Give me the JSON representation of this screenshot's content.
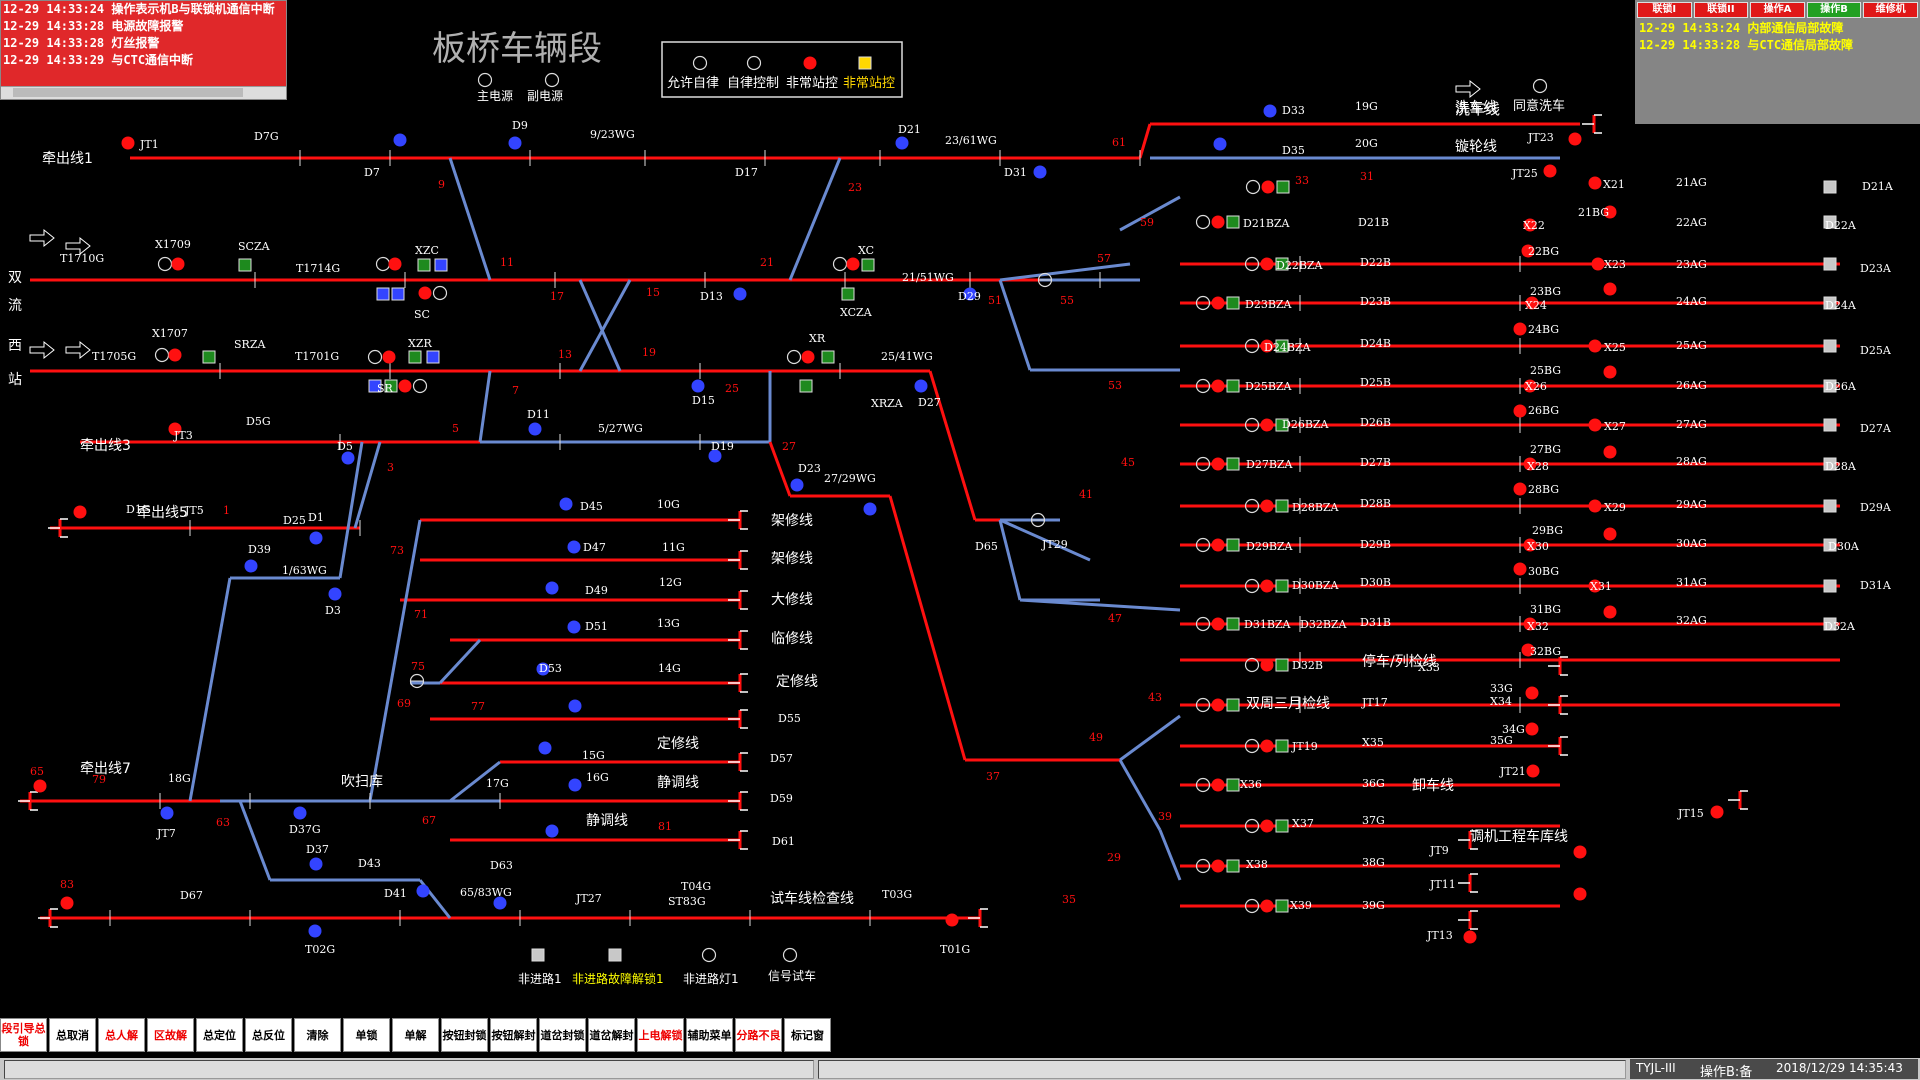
{
  "title": "板桥车辆段",
  "legend": {
    "indicators": [
      "允许自律",
      "自律控制",
      "非常站控",
      "非常站控"
    ],
    "power": [
      "主电源",
      "副电源"
    ],
    "wash": [
      "洗车线",
      "同意洗车"
    ]
  },
  "alarms_left": [
    "12-29 14:33:24 操作表示机B与联锁机通信中断",
    "12-29 14:33:28 电源故障报警",
    "12-29 14:33:28 灯丝报警",
    "12-29 14:33:29 与CTC通信中断"
  ],
  "alarms_right": {
    "tabs": [
      "联锁I",
      "联锁II",
      "操作A",
      "操作B",
      "维修机"
    ],
    "lines": [
      "12-29 14:33:24 内部通信局部故障",
      "12-29 14:33:28 与CTC通信局部故障"
    ]
  },
  "toolbar": [
    "段引导总锁",
    "总取消",
    "总人解",
    "区故解",
    "总定位",
    "总反位",
    "清除",
    "单锁",
    "单解",
    "按钮封锁",
    "按钮解封",
    "道岔封锁",
    "道岔解封",
    "上电解锁",
    "辅助菜单",
    "分路不良",
    "标记窗"
  ],
  "status": {
    "system": "TYJL-III",
    "mode": "操作B:备",
    "time": "2018/12/29 14:35:43"
  },
  "colors": {
    "route": "#ff1010",
    "track": "#6a8ad0",
    "alarm": "#e0282a",
    "signal_blue": "#3344ff",
    "signal_red": "#ff1010",
    "signal_green": "#1e8a1e"
  },
  "bottom_buttons": [
    "非进路1",
    "非进路故障解锁1",
    "非进路灯1",
    "信号试车"
  ],
  "labels": [
    [
      "牵出线1",
      0
    ],
    [
      "牵出线3",
      0
    ],
    [
      "牵出线5",
      0
    ],
    [
      "牵出线7",
      0
    ],
    [
      "双",
      0
    ],
    [
      "流",
      0
    ],
    [
      "西",
      0
    ],
    [
      "站",
      0
    ],
    [
      "JT1",
      1
    ],
    [
      "D7G",
      1
    ],
    [
      "D9",
      1
    ],
    [
      "9/23WG",
      1
    ],
    [
      "D21",
      1
    ],
    [
      "23/61WG",
      1
    ],
    [
      "61",
      2
    ],
    [
      "D33",
      1
    ],
    [
      "19G",
      1
    ],
    [
      "20G",
      1
    ],
    [
      "D35",
      1
    ],
    [
      "JT23",
      1
    ],
    [
      "JT25",
      1
    ],
    [
      "洗车线",
      0
    ],
    [
      "镟轮线",
      0
    ],
    [
      "D7",
      1
    ],
    [
      "9",
      2
    ],
    [
      "D17",
      1
    ],
    [
      "23",
      2
    ],
    [
      "D31",
      1
    ],
    [
      "X1709",
      1
    ],
    [
      "SCZA",
      1
    ],
    [
      "XZC",
      1
    ],
    [
      "XC",
      1
    ],
    [
      "T1710G",
      1
    ],
    [
      "T1714G",
      1
    ],
    [
      "11",
      2
    ],
    [
      "21",
      2
    ],
    [
      "21/51WG",
      1
    ],
    [
      "57",
      2
    ],
    [
      "59",
      2
    ],
    [
      "SC",
      1
    ],
    [
      "17",
      2
    ],
    [
      "15",
      2
    ],
    [
      "D13",
      1
    ],
    [
      "XCZA",
      1
    ],
    [
      "D29",
      1
    ],
    [
      "51",
      2
    ],
    [
      "55",
      2
    ],
    [
      "X1707",
      1
    ],
    [
      "SRZA",
      1
    ],
    [
      "XZR",
      1
    ],
    [
      "XR",
      1
    ],
    [
      "T1705G",
      1
    ],
    [
      "T1701G",
      1
    ],
    [
      "13",
      2
    ],
    [
      "19",
      2
    ],
    [
      "25/41WG",
      1
    ],
    [
      "SR",
      1
    ],
    [
      "7",
      2
    ],
    [
      "D15",
      1
    ],
    [
      "25",
      2
    ],
    [
      "XRZA",
      1
    ],
    [
      "D27",
      1
    ],
    [
      "53",
      2
    ],
    [
      "JT3",
      1
    ],
    [
      "D5G",
      1
    ],
    [
      "5",
      2
    ],
    [
      "D11",
      1
    ],
    [
      "5/27WG",
      1
    ],
    [
      "D5",
      1
    ],
    [
      "3",
      2
    ],
    [
      "D19",
      1
    ],
    [
      "27",
      2
    ],
    [
      "D23",
      1
    ],
    [
      "27/29WG",
      1
    ],
    [
      "JT5",
      1
    ],
    [
      "D1G",
      1
    ],
    [
      "1",
      2
    ],
    [
      "D1",
      1
    ],
    [
      "D25",
      1
    ],
    [
      "D39",
      1
    ],
    [
      "1/63WG",
      1
    ],
    [
      "D3",
      1
    ],
    [
      "D45",
      1
    ],
    [
      "10G",
      1
    ],
    [
      "架修线",
      0
    ],
    [
      "D47",
      1
    ],
    [
      "11G",
      1
    ],
    [
      "架修线",
      0
    ],
    [
      "73",
      2
    ],
    [
      "D49",
      1
    ],
    [
      "12G",
      1
    ],
    [
      "大修线",
      0
    ],
    [
      "71",
      2
    ],
    [
      "D51",
      1
    ],
    [
      "13G",
      1
    ],
    [
      "临修线",
      0
    ],
    [
      "75",
      2
    ],
    [
      "D53",
      1
    ],
    [
      "14G",
      1
    ],
    [
      "定修线",
      0
    ],
    [
      "69",
      2
    ],
    [
      "77",
      2
    ],
    [
      "D55",
      1
    ],
    [
      "15G",
      1
    ],
    [
      "定修线",
      0
    ],
    [
      "D57",
      1
    ],
    [
      "16G",
      1
    ],
    [
      "静调线",
      0
    ],
    [
      "D59",
      1
    ],
    [
      "17G",
      1
    ],
    [
      "静调线",
      0
    ],
    [
      "81",
      2
    ],
    [
      "D61",
      1
    ],
    [
      "18G",
      1
    ],
    [
      "吹扫库",
      0
    ],
    [
      "63",
      2
    ],
    [
      "67",
      2
    ],
    [
      "65",
      2
    ],
    [
      "79",
      2
    ],
    [
      "JT7",
      1
    ],
    [
      "D37G",
      1
    ],
    [
      "D37",
      1
    ],
    [
      "D43",
      1
    ],
    [
      "D41",
      1
    ],
    [
      "65/83WG",
      1
    ],
    [
      "D63",
      1
    ],
    [
      "83",
      2
    ],
    [
      "D67",
      1
    ],
    [
      "JT27",
      1
    ],
    [
      "T04G",
      1
    ],
    [
      "ST83G",
      1
    ],
    [
      "试车线检查线",
      0
    ],
    [
      "T03G",
      1
    ],
    [
      "T02G",
      1
    ],
    [
      "T01G",
      1
    ],
    [
      "D65",
      1
    ],
    [
      "JT29",
      1
    ],
    [
      "41",
      2
    ],
    [
      "45",
      2
    ],
    [
      "47",
      2
    ],
    [
      "49",
      2
    ],
    [
      "43",
      2
    ],
    [
      "37",
      2
    ],
    [
      "39",
      2
    ],
    [
      "29",
      2
    ],
    [
      "35",
      2
    ],
    [
      "33",
      2
    ],
    [
      "31",
      2
    ],
    [
      "X21",
      1
    ],
    [
      "21AG",
      1
    ],
    [
      "D21A",
      1
    ],
    [
      "21BG",
      1
    ],
    [
      "D21BZA",
      1
    ],
    [
      "D21B",
      1
    ],
    [
      "X22",
      1
    ],
    [
      "22AG",
      1
    ],
    [
      "D22A",
      1
    ],
    [
      "22BG",
      1
    ],
    [
      "D22BZA",
      1
    ],
    [
      "D22B",
      1
    ],
    [
      "X23",
      1
    ],
    [
      "23AG",
      1
    ],
    [
      "D23A",
      1
    ],
    [
      "23BG",
      1
    ],
    [
      "D23BZA",
      1
    ],
    [
      "D23B",
      1
    ],
    [
      "X24",
      1
    ],
    [
      "24AG",
      1
    ],
    [
      "D24A",
      1
    ],
    [
      "24BG",
      1
    ],
    [
      "D24BZA",
      1
    ],
    [
      "D24B",
      1
    ],
    [
      "X25",
      1
    ],
    [
      "25AG",
      1
    ],
    [
      "D25A",
      1
    ],
    [
      "25BG",
      1
    ],
    [
      "D25BZA",
      1
    ],
    [
      "D25B",
      1
    ],
    [
      "X26",
      1
    ],
    [
      "26AG",
      1
    ],
    [
      "D26A",
      1
    ],
    [
      "26BG",
      1
    ],
    [
      "D26BZA",
      1
    ],
    [
      "D26B",
      1
    ],
    [
      "X27",
      1
    ],
    [
      "27AG",
      1
    ],
    [
      "D27A",
      1
    ],
    [
      "27BG",
      1
    ],
    [
      "D27BZA",
      1
    ],
    [
      "D27B",
      1
    ],
    [
      "X28",
      1
    ],
    [
      "28AG",
      1
    ],
    [
      "D28A",
      1
    ],
    [
      "28BG",
      1
    ],
    [
      "D28BZA",
      1
    ],
    [
      "D28B",
      1
    ],
    [
      "X29",
      1
    ],
    [
      "29AG",
      1
    ],
    [
      "D29A",
      1
    ],
    [
      "29BG",
      1
    ],
    [
      "D29BZA",
      1
    ],
    [
      "D29B",
      1
    ],
    [
      "X30",
      1
    ],
    [
      "30AG",
      1
    ],
    [
      "D30A",
      1
    ],
    [
      "30BG",
      1
    ],
    [
      "D30BZA",
      1
    ],
    [
      "D30B",
      1
    ],
    [
      "X31",
      1
    ],
    [
      "31AG",
      1
    ],
    [
      "D31A",
      1
    ],
    [
      "31BG",
      1
    ],
    [
      "D31BZA",
      1
    ],
    [
      "D31B",
      1
    ],
    [
      "X32",
      1
    ],
    [
      "32AG",
      1
    ],
    [
      "D32A",
      1
    ],
    [
      "32BG",
      1
    ],
    [
      "D32BZA",
      1
    ],
    [
      "D32B",
      1
    ],
    [
      "停车/列检线",
      0
    ],
    [
      "X33",
      1
    ],
    [
      "33G",
      1
    ],
    [
      "双周三月检线",
      0
    ],
    [
      "JT17",
      1
    ],
    [
      "X34",
      1
    ],
    [
      "34G",
      1
    ],
    [
      "JT19",
      1
    ],
    [
      "X35",
      1
    ],
    [
      "35G",
      1
    ],
    [
      "JT21",
      1
    ],
    [
      "X36",
      1
    ],
    [
      "36G",
      1
    ],
    [
      "卸车线",
      0
    ],
    [
      "JT15",
      1
    ],
    [
      "X37",
      1
    ],
    [
      "37G",
      1
    ],
    [
      "调机工程车库线",
      0
    ],
    [
      "JT9",
      1
    ],
    [
      "X38",
      1
    ],
    [
      "38G",
      1
    ],
    [
      "JT11",
      1
    ],
    [
      "X39",
      1
    ],
    [
      "39G",
      1
    ],
    [
      "JT13",
      1
    ]
  ]
}
